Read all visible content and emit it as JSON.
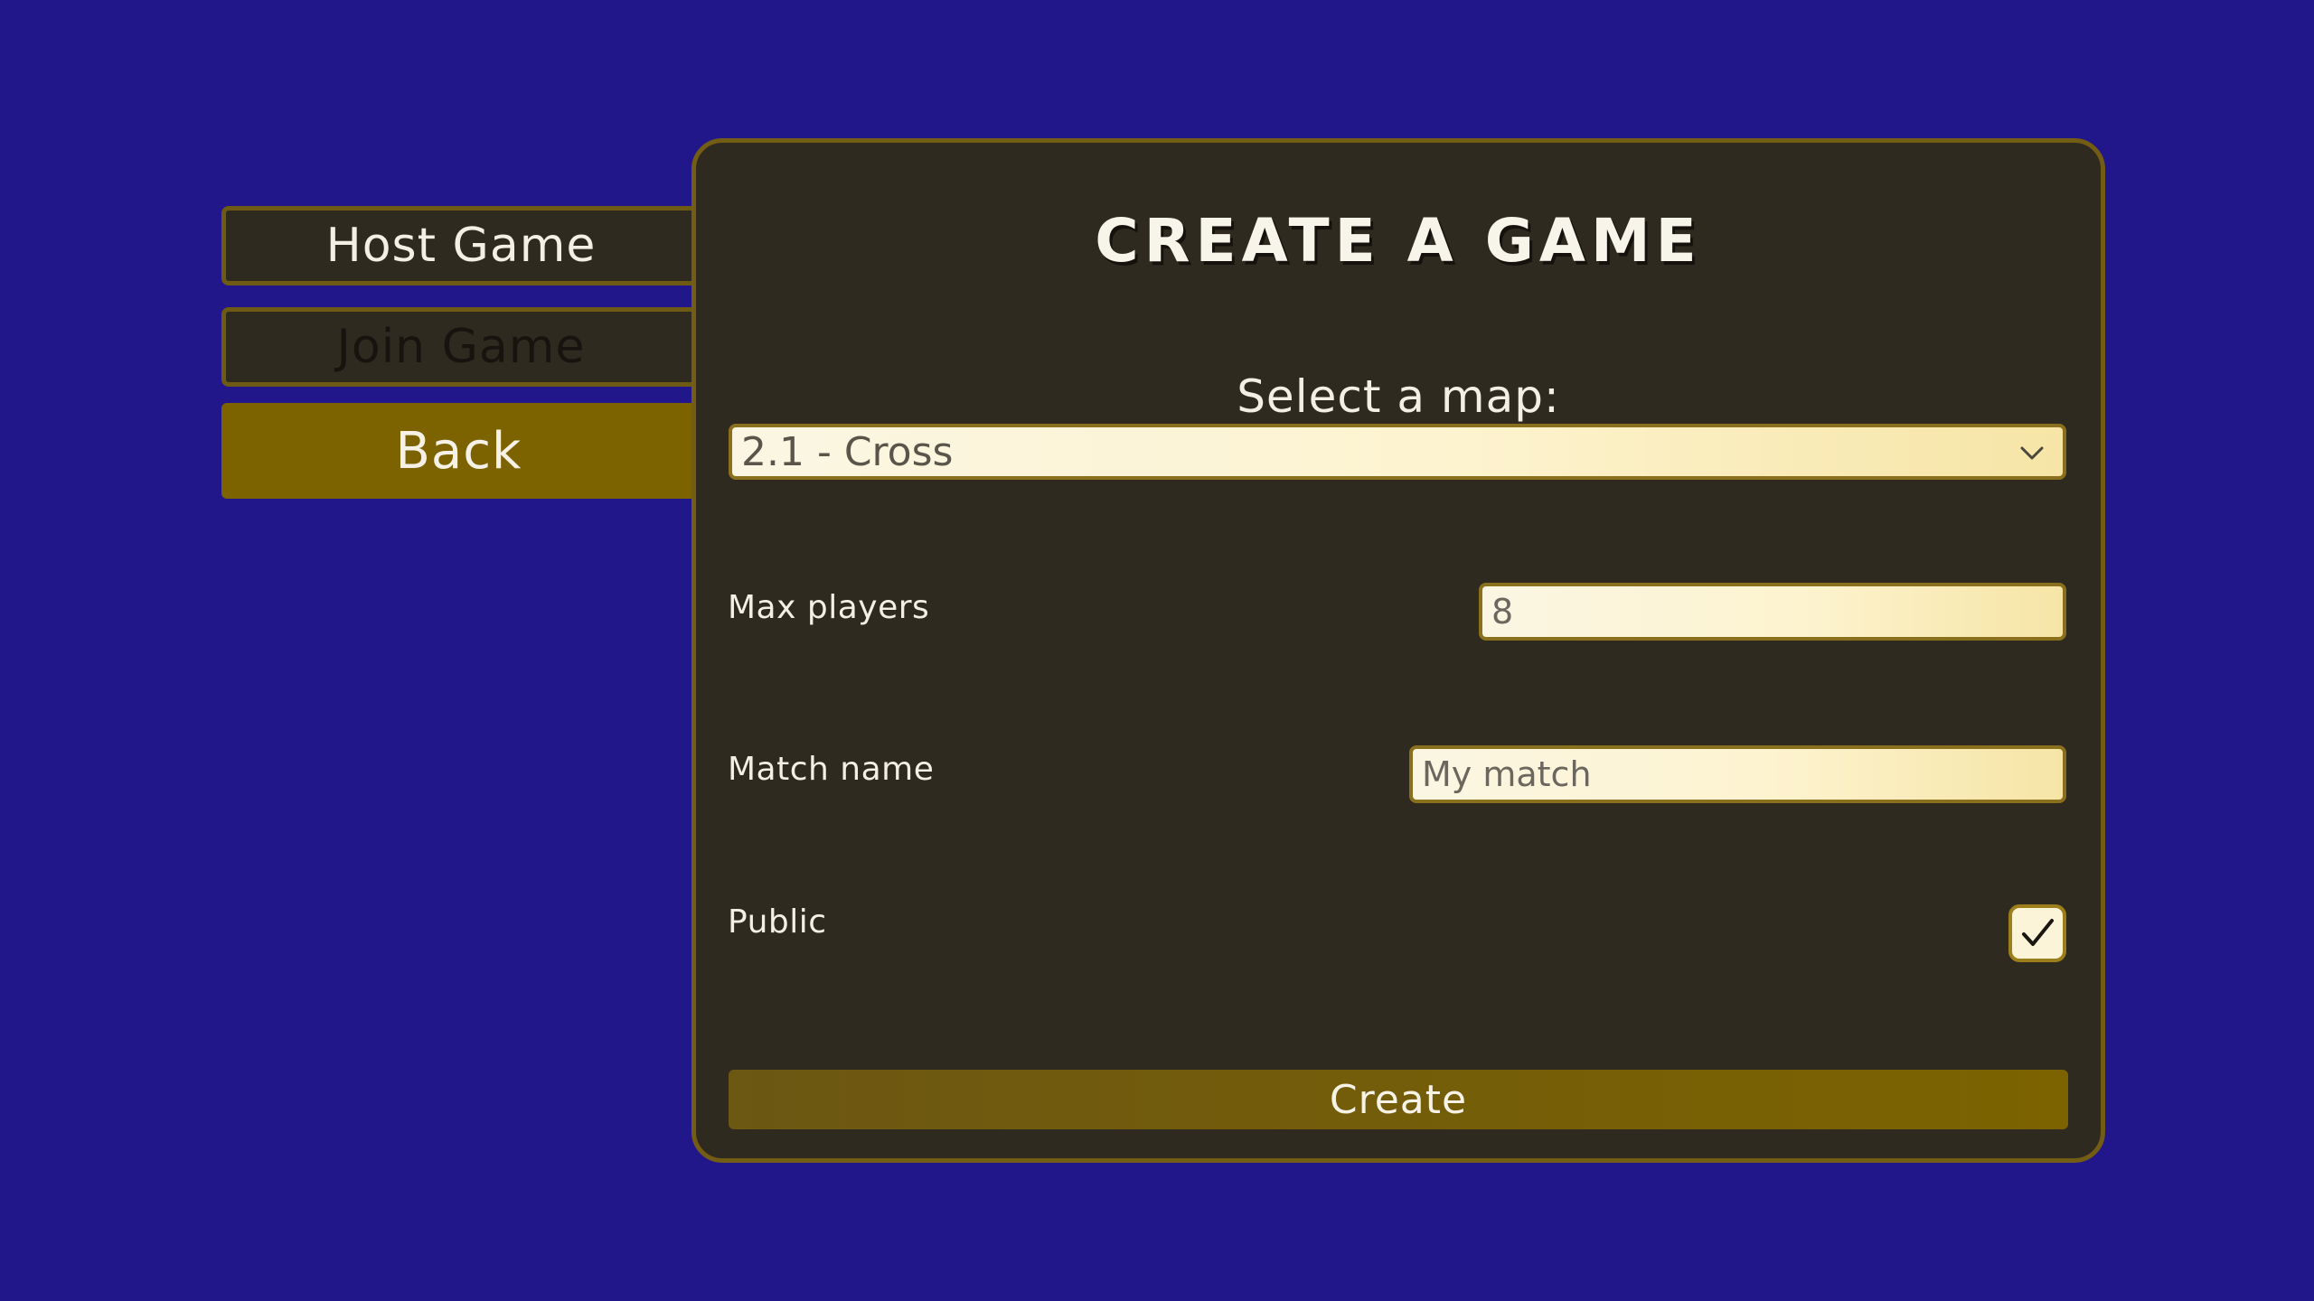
{
  "sidebar": {
    "host_label": "Host Game",
    "join_label": "Join Game",
    "back_label": "Back"
  },
  "panel": {
    "title": "CREATE A GAME",
    "map_label": "Select a map:",
    "map_selected": "2.1 - Cross",
    "max_players_label": "Max players",
    "max_players_value": "8",
    "match_name_label": "Match name",
    "match_name_placeholder": "My match",
    "public_label": "Public",
    "public_checked": true,
    "create_label": "Create"
  },
  "colors": {
    "background": "#21168a",
    "panel": "#2f2a20",
    "accent": "#7c6300"
  },
  "icons": {
    "dropdown": "chevron-down-icon",
    "checkbox": "check-icon"
  }
}
